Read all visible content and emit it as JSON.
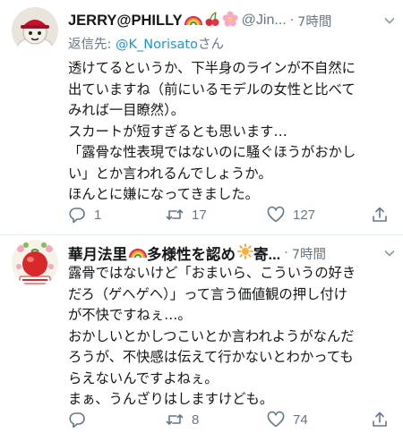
{
  "tweets": [
    {
      "display_name": "JERRY@PHILLY",
      "handle": "@Jin...",
      "time": "7時間",
      "reply_label": "返信先: ",
      "reply_handle": "@K_Norisato",
      "reply_suffix": "さん",
      "body_lines": [
        "透けてるというか、下半身のラインが不自然に",
        "出ていますね（前にいるモデルの女性と比べて",
        "みれば一目瞭然）。",
        "スカートが短すぎるとも思います…",
        "「露骨な性表現ではないのに騒ぐほうがおかし",
        "い」とか言われるんでしょうか。",
        "ほんとに嫌になってきました。"
      ],
      "replies": "1",
      "retweets": "17",
      "likes": "127"
    },
    {
      "display_name": "華月法里",
      "name_suffix": "多様性を認め",
      "name_end": "寄...",
      "time": "7時間",
      "body_lines": [
        "露骨ではないけど「おまいら、こういうの好き",
        "だろ（ゲヘゲヘ）」って言う価値観の押し付け",
        "が不快ですねぇ…。",
        "おかしいとかしつこいとか言われようがなんだ",
        "ろうが、不快感は伝えて行かないとわかっても",
        "らえないんですよねぇ。",
        "まぁ、うんざりはしますけども。"
      ],
      "retweets": "8",
      "likes": "74"
    }
  ],
  "separator_dot": "·",
  "colors": {
    "text": "#14171a",
    "secondary": "#657786",
    "link": "#1b95e0",
    "separator": "#e6ecf0"
  },
  "icons": [
    "reply-icon",
    "retweet-icon",
    "like-icon",
    "share-icon",
    "chevron-down-icon",
    "rainbow-icon",
    "cherries-icon",
    "blossom-icon",
    "sun-icon"
  ]
}
